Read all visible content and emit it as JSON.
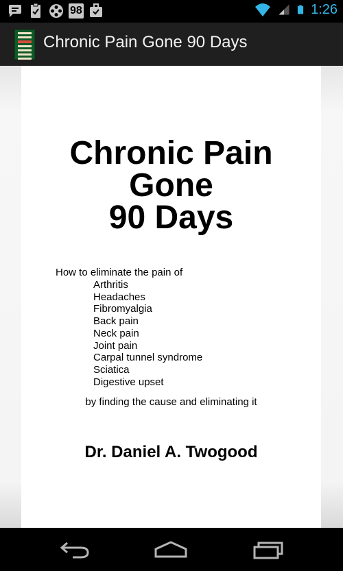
{
  "status_bar": {
    "notification_badge": "98",
    "time": "1:26",
    "icons": [
      "chat-icon",
      "clipboard-check-icon",
      "film-reel-icon",
      "badge-98-icon",
      "briefcase-check-icon",
      "wifi-icon",
      "signal-icon",
      "battery-icon"
    ]
  },
  "action_bar": {
    "title": "Chronic Pain Gone 90 Days"
  },
  "book": {
    "title_lines": [
      "Chronic Pain",
      "Gone",
      "90 Days"
    ],
    "intro": "How to eliminate the pain of",
    "conditions": [
      "Arthritis",
      "Headaches",
      "Fibromyalgia",
      "Back pain",
      "Neck pain",
      "Joint pain",
      "Carpal tunnel syndrome",
      "Sciatica",
      "Digestive upset"
    ],
    "tagline": "by finding the cause and eliminating it",
    "author": "Dr. Daniel A. Twogood"
  },
  "nav_bar": {
    "icons": [
      "back-icon",
      "home-icon",
      "recents-icon"
    ]
  },
  "colors": {
    "clock": "#33b5e5",
    "action_bar_bg": "#1f1f1f",
    "page_bg": "#ffffff"
  }
}
